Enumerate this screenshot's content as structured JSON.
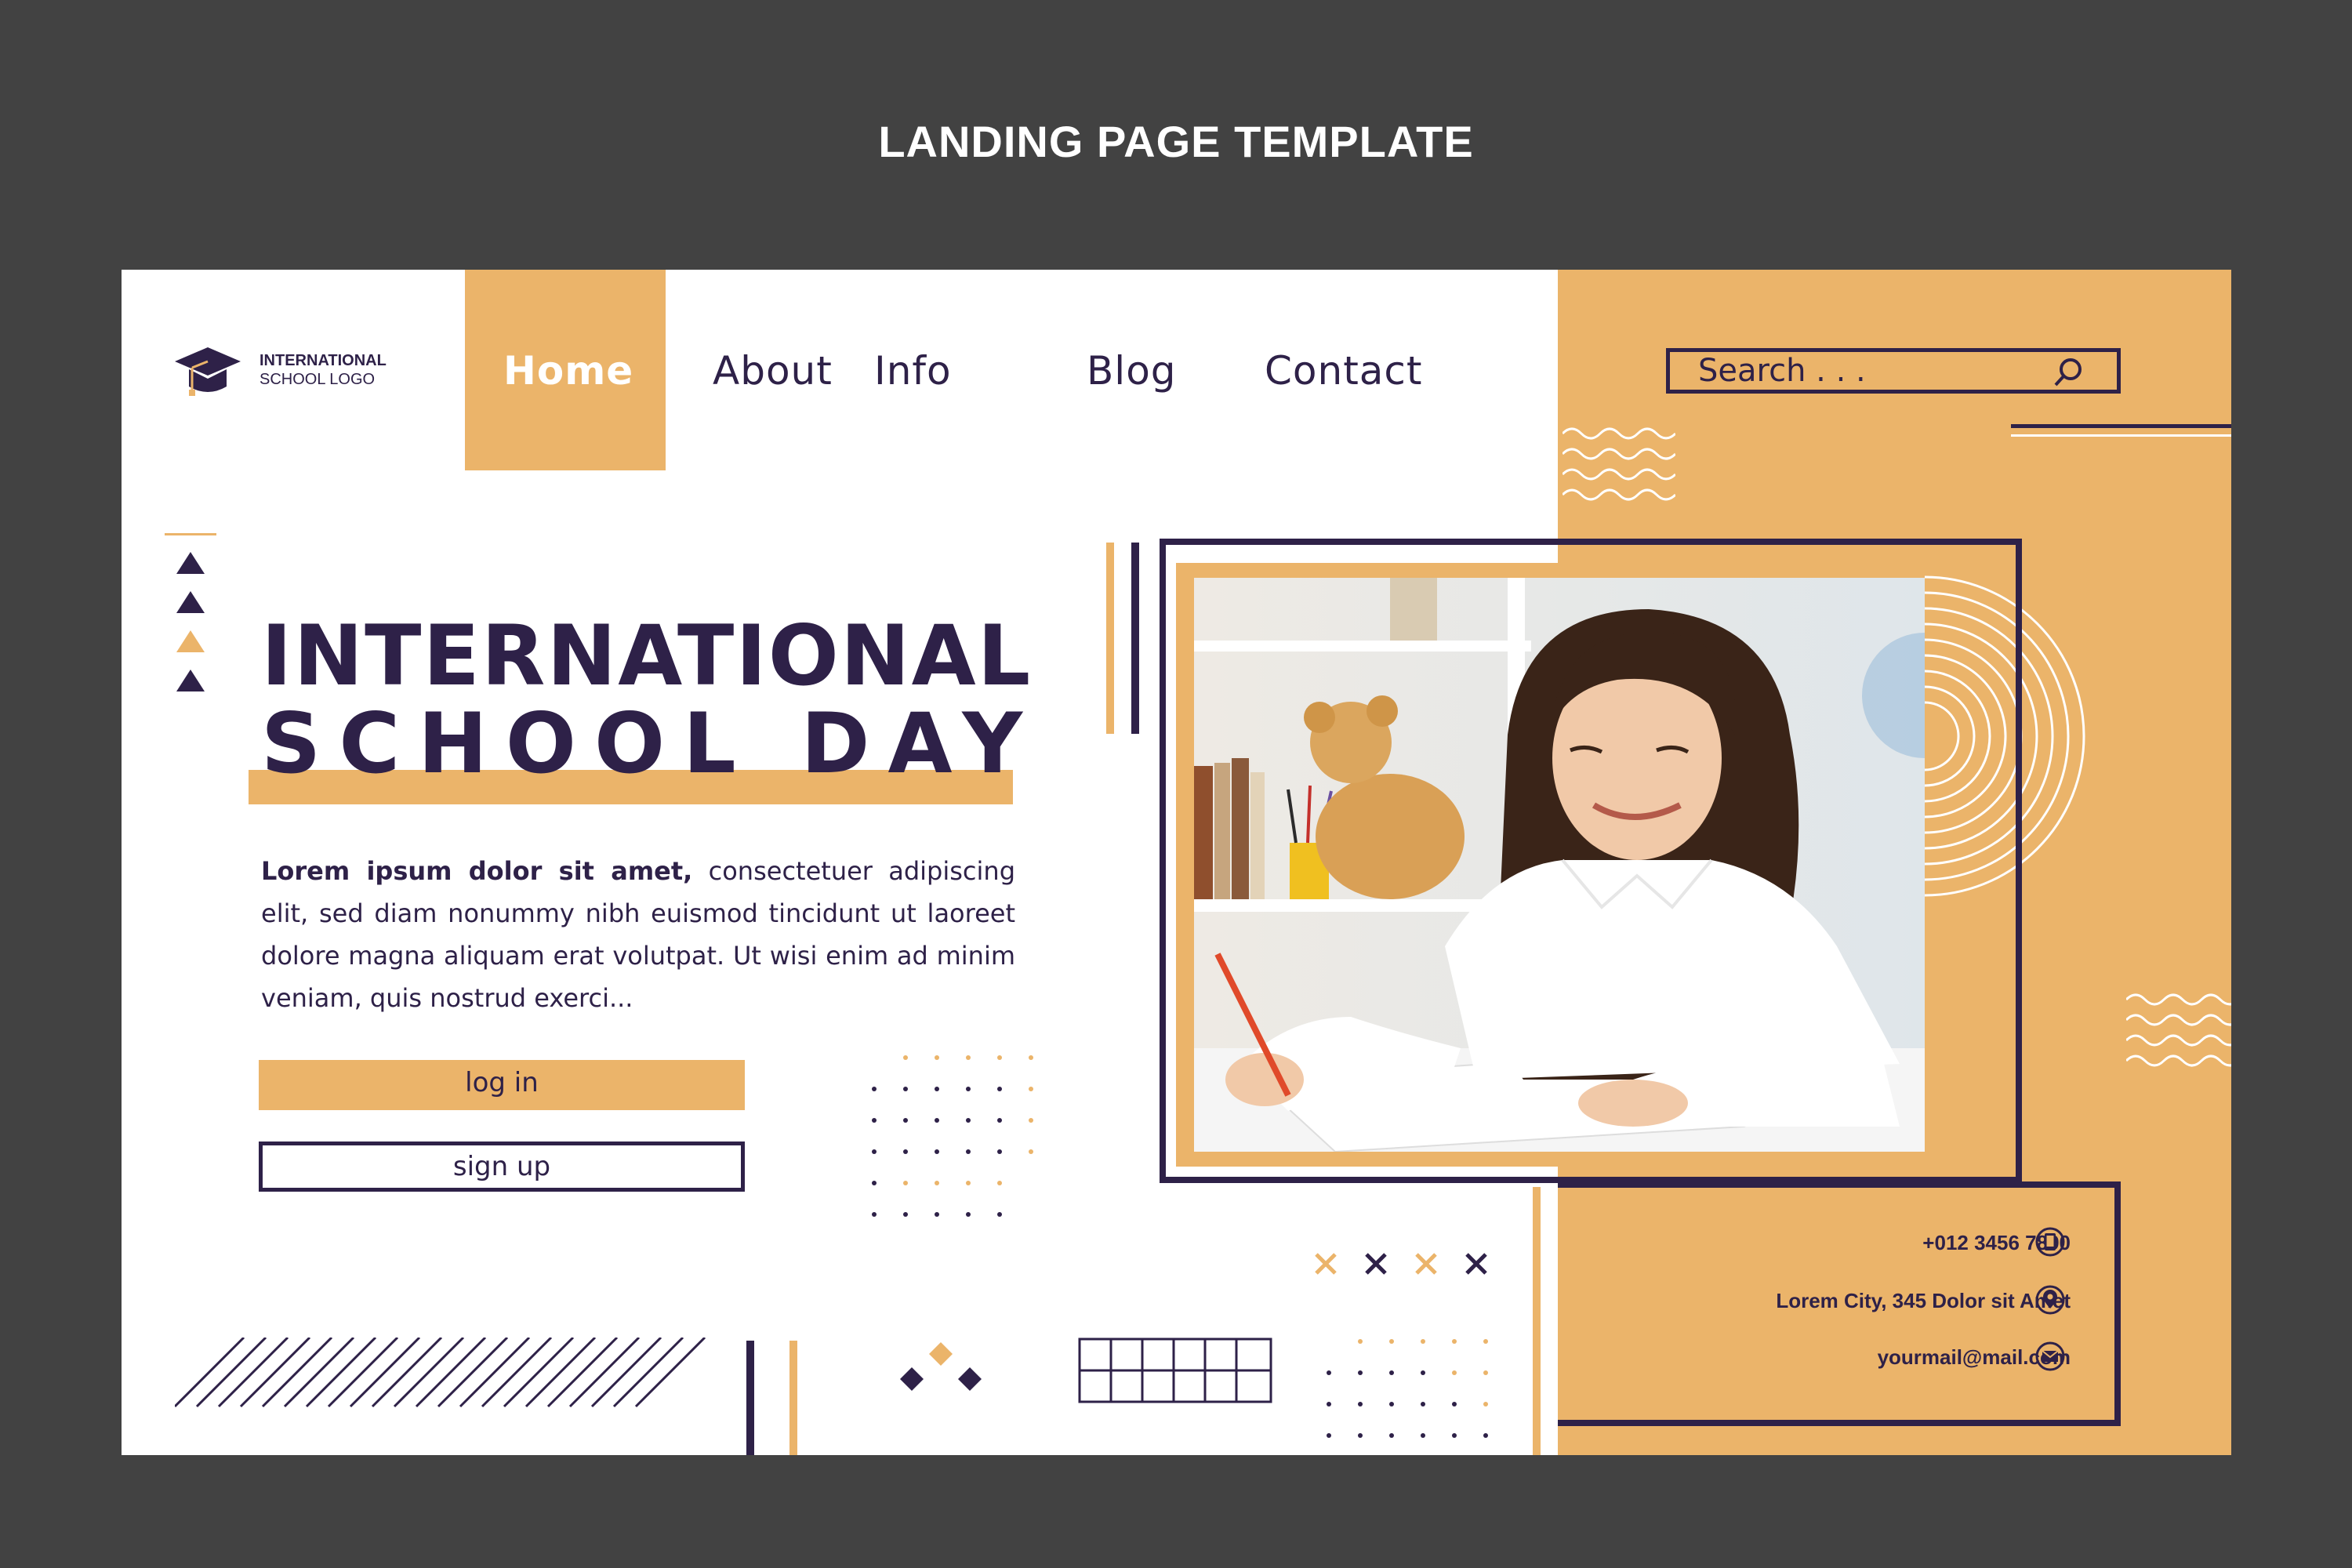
{
  "caption": "LANDING PAGE TEMPLATE",
  "logo": {
    "icon": "graduation-cap-icon",
    "line1": "INTERNATIONAL",
    "line2": "SCHOOL LOGO"
  },
  "nav": {
    "items": [
      {
        "label": "Home",
        "active": true
      },
      {
        "label": "About",
        "active": false
      },
      {
        "label": "Info",
        "active": false
      },
      {
        "label": "Blog",
        "active": false
      },
      {
        "label": "Contact",
        "active": false
      }
    ]
  },
  "search": {
    "placeholder": "Search . . .",
    "icon": "search-icon"
  },
  "hero": {
    "title_line1": "INTERNATIONAL",
    "title_line2": "SCHOOL DAY",
    "body_bold": "Lorem ipsum dolor sit amet,",
    "body_rest": " consectetuer adipiscing elit, sed diam nonummy nibh euismod tincidunt ut laoreet dolore magna aliquam erat volutpat. Ut wisi enim ad minim veniam, quis nostrud exerci...",
    "login_label": "log in",
    "signup_label": "sign up"
  },
  "contact": {
    "phone": "+012 3456 7890",
    "address": "Lorem City, 345 Dolor sit Amet",
    "email": "yourmail@mail.com",
    "icons": [
      "phone-icon",
      "location-pin-icon",
      "mail-icon"
    ]
  },
  "colors": {
    "accent": "#ebb46a",
    "primary": "#2e2148",
    "background": "#424242"
  }
}
